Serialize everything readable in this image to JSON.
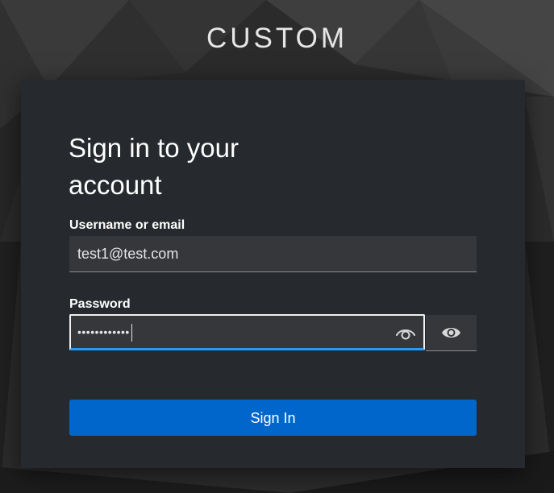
{
  "brand": {
    "title": "CUSTOM"
  },
  "login": {
    "title": "Sign in to your account",
    "username": {
      "label": "Username or email",
      "value": "test1@test.com"
    },
    "password": {
      "label": "Password",
      "masked_value": "••••••••••••"
    },
    "submit_label": "Sign In"
  },
  "colors": {
    "card_background": "#26292e",
    "input_background": "#36373b",
    "primary_button": "#0066cc",
    "focus_underline": "#2b9af3"
  },
  "icons": {
    "inline_toggle": "eye-outline-icon",
    "side_toggle": "eye-icon"
  }
}
